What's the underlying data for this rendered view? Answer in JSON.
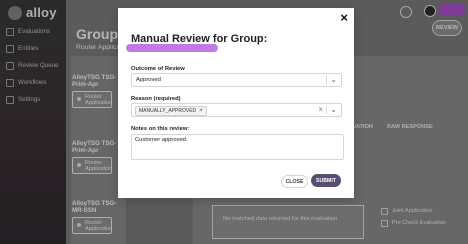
{
  "app": {
    "name": "alloy"
  },
  "sidebar": {
    "items": [
      {
        "label": "Evaluations",
        "icon": "chart-icon"
      },
      {
        "label": "Entities",
        "icon": "entities-icon"
      },
      {
        "label": "Review Queue",
        "icon": "review-queue-icon"
      },
      {
        "label": "Workflows",
        "icon": "workflow-icon"
      },
      {
        "label": "Settings",
        "icon": "settings-icon"
      }
    ]
  },
  "page": {
    "title": "Group",
    "subtitle": "Router Application"
  },
  "left_list": [
    {
      "name_line1": "AlloyTSG TSG-",
      "name_line2": "Prim-Apr",
      "tag_line1": "Router",
      "tag_line2": "Application"
    },
    {
      "name_line1": "AlloyTSG TSG-",
      "name_line2": "Prim-Apr",
      "tag_line1": "Router",
      "tag_line2": "Application"
    },
    {
      "name_line1": "AlloyTSG TSG-",
      "name_line2": "MR-SSN",
      "tag_line1": "Router",
      "tag_line2": "Application"
    }
  ],
  "right_panel": {
    "review_button": "REVIEW",
    "tabs": [
      "RERUN EVALUATION",
      "RAW RESPONSE"
    ],
    "bottom_text": "No matched data returned for this evaluation",
    "checklist": [
      "Joint Application",
      "Pre Check Evaluation"
    ]
  },
  "modal": {
    "title": "Manual Review for Group:",
    "close_symbol": "×",
    "outcome": {
      "label": "Outcome of Review",
      "value": "Approved"
    },
    "reason": {
      "label": "Reason (required)",
      "chip": "MANUALLY_APPROVED"
    },
    "notes": {
      "label": "Notes on this review:",
      "value": "Customer approved."
    },
    "buttons": {
      "close": "CLOSE",
      "submit": "SUBMIT"
    }
  },
  "colors": {
    "accent_purple": "#b04bd8",
    "submit_button": "#5a4d74"
  }
}
